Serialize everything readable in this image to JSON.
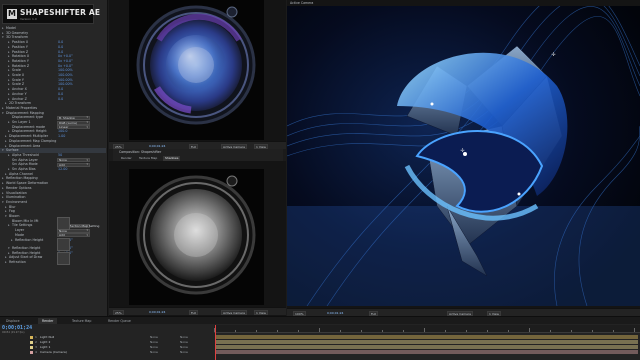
{
  "logo": {
    "mark": "M",
    "name": "SHAPESHIFTER AE",
    "version": "Version 1.0"
  },
  "fx_rows": [
    {
      "tri": "▸",
      "label": "Model",
      "indent": 0
    },
    {
      "tri": "▸",
      "label": "3D Geometry",
      "indent": 0
    },
    {
      "tri": "▾",
      "label": "3D Transform",
      "indent": 0
    },
    {
      "tri": "▸",
      "label": "Position X",
      "indent": 2,
      "value": "0.0"
    },
    {
      "tri": "▸",
      "label": "Position Y",
      "indent": 2,
      "value": "0.0"
    },
    {
      "tri": "▸",
      "label": "Position Z",
      "indent": 2,
      "value": "0.0"
    },
    {
      "tri": "▸",
      "label": "Rotation X",
      "indent": 2,
      "value": "0x +0.0°"
    },
    {
      "tri": "▸",
      "label": "Rotation Y",
      "indent": 2,
      "value": "0x +0.0°"
    },
    {
      "tri": "▸",
      "label": "Rotation Z",
      "indent": 2,
      "value": "0x +0.0°"
    },
    {
      "tri": "▸",
      "label": "Scale",
      "indent": 2,
      "value": "100.00%"
    },
    {
      "tri": "▸",
      "label": "Scale X",
      "indent": 2,
      "value": "100.00%"
    },
    {
      "tri": "▸",
      "label": "Scale Y",
      "indent": 2,
      "value": "100.00%"
    },
    {
      "tri": "▸",
      "label": "Scale Z",
      "indent": 2,
      "value": "100.00%"
    },
    {
      "tri": "▸",
      "label": "Anchor X",
      "indent": 2,
      "value": "0.0"
    },
    {
      "tri": "▸",
      "label": "Anchor Y",
      "indent": 2,
      "value": "0.0"
    },
    {
      "tri": "▸",
      "label": "Anchor Z",
      "indent": 2,
      "value": "0.0"
    },
    {
      "tri": "▸",
      "label": "2D Transform",
      "indent": 1
    },
    {
      "tri": "▸",
      "label": "Material Properties",
      "indent": 0
    },
    {
      "tri": "▾",
      "label": "Displacement Mapping",
      "indent": 0
    },
    {
      "tri": "",
      "label": "Displacement type",
      "indent": 2,
      "dropdown": "B. Shadow"
    },
    {
      "tri": "▸",
      "label": "Src Layer 1",
      "indent": 2,
      "dropdown": "RGB (Luma)"
    },
    {
      "tri": "",
      "label": "Displacement mode",
      "indent": 2,
      "dropdown": "Linear"
    },
    {
      "tri": "▸",
      "label": "Displacement Height",
      "indent": 2,
      "value": "100.0"
    },
    {
      "tri": "▸",
      "label": "Displacement Multiplier",
      "indent": 1,
      "value": "1.00"
    },
    {
      "tri": "▸",
      "label": "Displacement Map Clamping",
      "indent": 1
    },
    {
      "tri": "▸",
      "label": "Displacement Area",
      "indent": 1
    },
    {
      "tri": "▾",
      "label": "Surface",
      "indent": 0,
      "selected": true
    },
    {
      "tri": "▸",
      "label": "Alpha Threshold",
      "indent": 2,
      "value": "50"
    },
    {
      "tri": "",
      "label": "Src Alpha Layer",
      "indent": 2,
      "dropdown": "None"
    },
    {
      "tri": "",
      "label": "Src Alpha Mode",
      "indent": 2,
      "dropdown": "Add"
    },
    {
      "tri": "▸",
      "label": "Src Alpha Bias",
      "indent": 2,
      "value": "12.00"
    },
    {
      "tri": "▸",
      "label": "Alpha Channel",
      "indent": 1
    },
    {
      "tri": "▸",
      "label": "Reflection Mapping",
      "indent": 0
    },
    {
      "tri": "▸",
      "label": "World Space Deformation",
      "indent": 0
    },
    {
      "tri": "▸",
      "label": "Render Options",
      "indent": 0
    },
    {
      "tri": "▸",
      "label": "Visualization",
      "indent": 0
    },
    {
      "tri": "▸",
      "label": "Illumination",
      "indent": 0
    },
    {
      "tri": "▾",
      "label": "Environment",
      "indent": 0
    },
    {
      "tri": "▸",
      "label": "Blur",
      "indent": 1
    },
    {
      "tri": "▸",
      "label": "Fog",
      "indent": 1
    },
    {
      "tri": "▾",
      "label": "Bloom",
      "indent": 1
    },
    {
      "tri": "",
      "label": "Bloom Mix In Mt",
      "indent": 2
    },
    {
      "tri": "▸",
      "label": "Tile Settings",
      "indent": 2,
      "dropdown": "Use Reflection Map Setting"
    },
    {
      "tri": "",
      "label": "Layer",
      "indent": 3,
      "dropdown": "None"
    },
    {
      "tri": "",
      "label": "Mode",
      "indent": 3,
      "dropdown": "Add"
    },
    {
      "tri": "▸",
      "label": "Reflection Height",
      "indent": 3,
      "value": "0x +0.0°"
    }
  ],
  "fx_rows_lower": [
    {
      "tri": "▾",
      "label": "Reflection Height",
      "indent": 2,
      "value": "0x +0.0°"
    },
    {
      "tri": "▸",
      "label": "Reflection Height",
      "indent": 2,
      "value": "0x +0.0°"
    },
    {
      "tri": "▸",
      "label": "Adjust Start of Draw",
      "indent": 1,
      "value": "0"
    },
    {
      "tri": "▸",
      "label": "Refraction",
      "indent": 1,
      "value": "0"
    }
  ],
  "viewer_top": {
    "zoom": "25%",
    "timecode": "0;00;01;24",
    "quality": "Full",
    "camera": "Active Camera",
    "view": "1 View"
  },
  "comp_panel": {
    "title": "Composition: Shapeshifter",
    "tabs": [
      "Render",
      "Texture Map",
      "Shadows"
    ],
    "active_tab": 2
  },
  "viewer_bottom": {
    "zoom": "25%",
    "timecode": "0;00;01;24",
    "quality": "Full",
    "camera": "Active Camera",
    "view": "1 View"
  },
  "viewer_main": {
    "label": "Active Camera",
    "zoom": "100%",
    "timecode": "0;00;01;24",
    "quality": "Full",
    "camera": "Active Camera",
    "view": "1 View"
  },
  "timeline": {
    "tabs": [
      "Displace",
      "Render",
      "Texture Map",
      "Render Queue"
    ],
    "active_tab": 1,
    "timecode": "0;00;01;24",
    "fps": "00054 (29.97 fps)",
    "layers": [
      {
        "num": "1",
        "name": "Light Null",
        "chip": "#d7b65a",
        "mode": "None",
        "parent": "None"
      },
      {
        "num": "2",
        "name": "Light 2",
        "chip": "#e0d08a",
        "mode": "None",
        "parent": "None"
      },
      {
        "num": "3",
        "name": "Light 1",
        "chip": "#e0d08a",
        "mode": "None",
        "parent": "None"
      },
      {
        "num": "4",
        "name": "Camera (Camera)",
        "chip": "#d4a0a0",
        "mode": "None",
        "parent": "None"
      }
    ]
  },
  "colors": {
    "accent": "#5da0e6",
    "panel": "#262626",
    "viewer_bg": "#050505"
  }
}
